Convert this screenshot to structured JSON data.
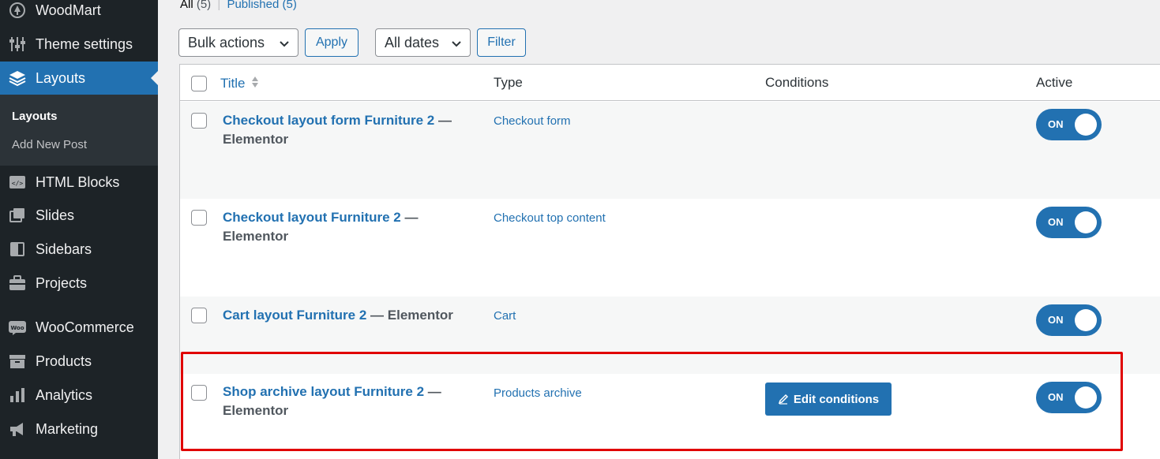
{
  "sidebar": {
    "items": [
      {
        "label": "WoodMart",
        "icon": "woodmart-icon"
      },
      {
        "label": "Theme settings",
        "icon": "sliders-icon"
      },
      {
        "label": "Layouts",
        "icon": "layers-icon"
      },
      {
        "label": "HTML Blocks",
        "icon": "code-block-icon"
      },
      {
        "label": "Slides",
        "icon": "slides-icon"
      },
      {
        "label": "Sidebars",
        "icon": "sidebar-icon"
      },
      {
        "label": "Projects",
        "icon": "briefcase-icon"
      },
      {
        "label": "WooCommerce",
        "icon": "woocommerce-icon"
      },
      {
        "label": "Products",
        "icon": "archive-icon"
      },
      {
        "label": "Analytics",
        "icon": "bar-chart-icon"
      },
      {
        "label": "Marketing",
        "icon": "megaphone-icon"
      }
    ],
    "submenu": [
      {
        "label": "Layouts"
      },
      {
        "label": "Add New Post"
      }
    ]
  },
  "filters": {
    "all_label": "All",
    "all_count": "(5)",
    "separator": "|",
    "published_label": "Published",
    "published_count": "(5)",
    "bulk_actions": "Bulk actions",
    "apply": "Apply",
    "all_dates": "All dates",
    "filter": "Filter"
  },
  "table": {
    "headers": {
      "title": "Title",
      "type": "Type",
      "conditions": "Conditions",
      "active": "Active"
    },
    "rows": [
      {
        "title": "Checkout layout form Furniture 2",
        "suffix": "— Elementor",
        "type": "Checkout form",
        "toggle": "ON"
      },
      {
        "title": "Checkout layout Furniture 2",
        "suffix": "— Elementor",
        "type": "Checkout top content",
        "toggle": "ON"
      },
      {
        "title": "Cart layout Furniture 2",
        "suffix": "— Elementor",
        "type": "Cart",
        "toggle": "ON"
      },
      {
        "title": "Shop archive layout Furniture 2",
        "suffix": "— Elementor",
        "type": "Products archive",
        "toggle": "ON",
        "edit_conditions": "Edit conditions"
      }
    ]
  },
  "colors": {
    "accent": "#2271b1",
    "sidebar_bg": "#1d2327",
    "highlight": "#e00000"
  }
}
